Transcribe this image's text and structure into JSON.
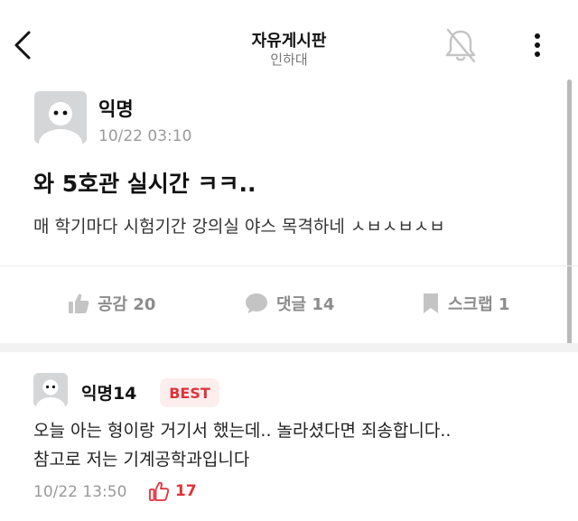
{
  "header": {
    "title": "자유게시판",
    "subtitle": "인하대",
    "back_icon": "chevron-left-icon",
    "bell_icon": "bell-off-icon",
    "more_icon": "more-vertical-icon"
  },
  "post": {
    "author": "익명",
    "time": "10/22 03:10",
    "title": "와 5호관 실시간 ㅋㅋ..",
    "body": "매 학기마다 시험기간 강의실 야스 목격하네 ㅅㅂㅅㅂㅅㅂ",
    "actions": {
      "like": {
        "icon": "thumbs-up-icon",
        "label": "공감 20"
      },
      "comment": {
        "icon": "speech-bubble-icon",
        "label": "댓글 14"
      },
      "scrap": {
        "icon": "bookmark-icon",
        "label": "스크랩 1"
      }
    }
  },
  "comment": {
    "author": "익명14",
    "badge": "BEST",
    "body_line1": "오늘 아는 형이랑 거기서 했는데.. 놀라셨다면 죄송합니다..",
    "body_line2": "참고로 저는 기계공학과입니다",
    "time": "10/22 13:50",
    "like_count": "17",
    "like_icon": "thumbs-up-outline-icon"
  },
  "colors": {
    "accent_red": "#e0323a",
    "muted_gray": "#8c8c8c",
    "avatar_gray": "#d4d6d8"
  }
}
